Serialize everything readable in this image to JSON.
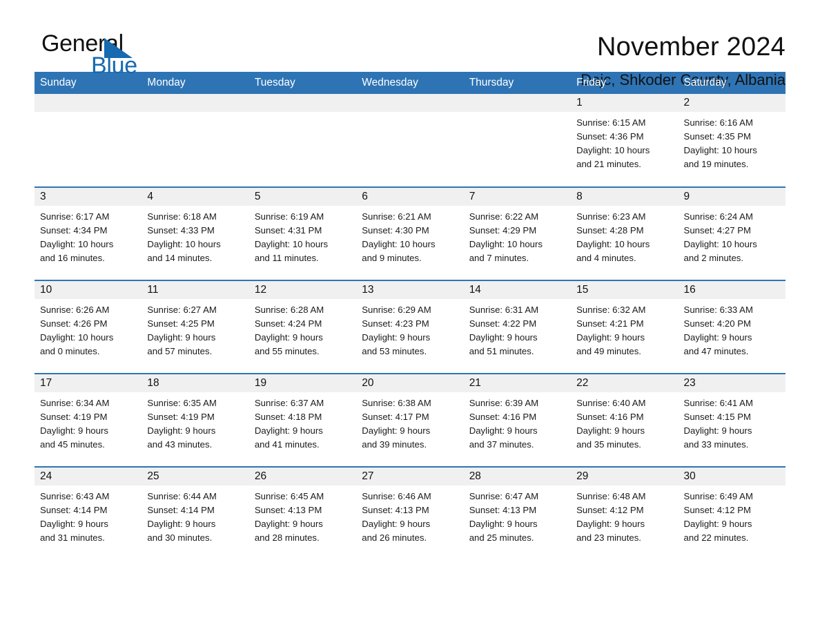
{
  "brand": {
    "name_part1": "General",
    "name_part2": "Blue",
    "triangle_icon": "brand-triangle-icon",
    "accent_color": "#1769b0"
  },
  "header": {
    "title": "November 2024",
    "subtitle": "Dajc, Shkoder County, Albania"
  },
  "colors": {
    "header_blue": "#2e74b5",
    "row_divider_blue": "#2e74b5",
    "daynum_band": "#f0f0f0",
    "text": "#111111",
    "page_background": "#ffffff"
  },
  "calendar": {
    "weekdays": [
      "Sunday",
      "Monday",
      "Tuesday",
      "Wednesday",
      "Thursday",
      "Friday",
      "Saturday"
    ],
    "labels": {
      "sunrise_prefix": "Sunrise: ",
      "sunset_prefix": "Sunset: ",
      "daylight_prefix": "Daylight: "
    },
    "weeks": [
      [
        {
          "day": "",
          "empty": true
        },
        {
          "day": "",
          "empty": true
        },
        {
          "day": "",
          "empty": true
        },
        {
          "day": "",
          "empty": true
        },
        {
          "day": "",
          "empty": true
        },
        {
          "day": "1",
          "sunrise": "Sunrise: 6:15 AM",
          "sunset": "Sunset: 4:36 PM",
          "daylight_line1": "Daylight: 10 hours",
          "daylight_line2": "and 21 minutes."
        },
        {
          "day": "2",
          "sunrise": "Sunrise: 6:16 AM",
          "sunset": "Sunset: 4:35 PM",
          "daylight_line1": "Daylight: 10 hours",
          "daylight_line2": "and 19 minutes."
        }
      ],
      [
        {
          "day": "3",
          "sunrise": "Sunrise: 6:17 AM",
          "sunset": "Sunset: 4:34 PM",
          "daylight_line1": "Daylight: 10 hours",
          "daylight_line2": "and 16 minutes."
        },
        {
          "day": "4",
          "sunrise": "Sunrise: 6:18 AM",
          "sunset": "Sunset: 4:33 PM",
          "daylight_line1": "Daylight: 10 hours",
          "daylight_line2": "and 14 minutes."
        },
        {
          "day": "5",
          "sunrise": "Sunrise: 6:19 AM",
          "sunset": "Sunset: 4:31 PM",
          "daylight_line1": "Daylight: 10 hours",
          "daylight_line2": "and 11 minutes."
        },
        {
          "day": "6",
          "sunrise": "Sunrise: 6:21 AM",
          "sunset": "Sunset: 4:30 PM",
          "daylight_line1": "Daylight: 10 hours",
          "daylight_line2": "and 9 minutes."
        },
        {
          "day": "7",
          "sunrise": "Sunrise: 6:22 AM",
          "sunset": "Sunset: 4:29 PM",
          "daylight_line1": "Daylight: 10 hours",
          "daylight_line2": "and 7 minutes."
        },
        {
          "day": "8",
          "sunrise": "Sunrise: 6:23 AM",
          "sunset": "Sunset: 4:28 PM",
          "daylight_line1": "Daylight: 10 hours",
          "daylight_line2": "and 4 minutes."
        },
        {
          "day": "9",
          "sunrise": "Sunrise: 6:24 AM",
          "sunset": "Sunset: 4:27 PM",
          "daylight_line1": "Daylight: 10 hours",
          "daylight_line2": "and 2 minutes."
        }
      ],
      [
        {
          "day": "10",
          "sunrise": "Sunrise: 6:26 AM",
          "sunset": "Sunset: 4:26 PM",
          "daylight_line1": "Daylight: 10 hours",
          "daylight_line2": "and 0 minutes."
        },
        {
          "day": "11",
          "sunrise": "Sunrise: 6:27 AM",
          "sunset": "Sunset: 4:25 PM",
          "daylight_line1": "Daylight: 9 hours",
          "daylight_line2": "and 57 minutes."
        },
        {
          "day": "12",
          "sunrise": "Sunrise: 6:28 AM",
          "sunset": "Sunset: 4:24 PM",
          "daylight_line1": "Daylight: 9 hours",
          "daylight_line2": "and 55 minutes."
        },
        {
          "day": "13",
          "sunrise": "Sunrise: 6:29 AM",
          "sunset": "Sunset: 4:23 PM",
          "daylight_line1": "Daylight: 9 hours",
          "daylight_line2": "and 53 minutes."
        },
        {
          "day": "14",
          "sunrise": "Sunrise: 6:31 AM",
          "sunset": "Sunset: 4:22 PM",
          "daylight_line1": "Daylight: 9 hours",
          "daylight_line2": "and 51 minutes."
        },
        {
          "day": "15",
          "sunrise": "Sunrise: 6:32 AM",
          "sunset": "Sunset: 4:21 PM",
          "daylight_line1": "Daylight: 9 hours",
          "daylight_line2": "and 49 minutes."
        },
        {
          "day": "16",
          "sunrise": "Sunrise: 6:33 AM",
          "sunset": "Sunset: 4:20 PM",
          "daylight_line1": "Daylight: 9 hours",
          "daylight_line2": "and 47 minutes."
        }
      ],
      [
        {
          "day": "17",
          "sunrise": "Sunrise: 6:34 AM",
          "sunset": "Sunset: 4:19 PM",
          "daylight_line1": "Daylight: 9 hours",
          "daylight_line2": "and 45 minutes."
        },
        {
          "day": "18",
          "sunrise": "Sunrise: 6:35 AM",
          "sunset": "Sunset: 4:19 PM",
          "daylight_line1": "Daylight: 9 hours",
          "daylight_line2": "and 43 minutes."
        },
        {
          "day": "19",
          "sunrise": "Sunrise: 6:37 AM",
          "sunset": "Sunset: 4:18 PM",
          "daylight_line1": "Daylight: 9 hours",
          "daylight_line2": "and 41 minutes."
        },
        {
          "day": "20",
          "sunrise": "Sunrise: 6:38 AM",
          "sunset": "Sunset: 4:17 PM",
          "daylight_line1": "Daylight: 9 hours",
          "daylight_line2": "and 39 minutes."
        },
        {
          "day": "21",
          "sunrise": "Sunrise: 6:39 AM",
          "sunset": "Sunset: 4:16 PM",
          "daylight_line1": "Daylight: 9 hours",
          "daylight_line2": "and 37 minutes."
        },
        {
          "day": "22",
          "sunrise": "Sunrise: 6:40 AM",
          "sunset": "Sunset: 4:16 PM",
          "daylight_line1": "Daylight: 9 hours",
          "daylight_line2": "and 35 minutes."
        },
        {
          "day": "23",
          "sunrise": "Sunrise: 6:41 AM",
          "sunset": "Sunset: 4:15 PM",
          "daylight_line1": "Daylight: 9 hours",
          "daylight_line2": "and 33 minutes."
        }
      ],
      [
        {
          "day": "24",
          "sunrise": "Sunrise: 6:43 AM",
          "sunset": "Sunset: 4:14 PM",
          "daylight_line1": "Daylight: 9 hours",
          "daylight_line2": "and 31 minutes."
        },
        {
          "day": "25",
          "sunrise": "Sunrise: 6:44 AM",
          "sunset": "Sunset: 4:14 PM",
          "daylight_line1": "Daylight: 9 hours",
          "daylight_line2": "and 30 minutes."
        },
        {
          "day": "26",
          "sunrise": "Sunrise: 6:45 AM",
          "sunset": "Sunset: 4:13 PM",
          "daylight_line1": "Daylight: 9 hours",
          "daylight_line2": "and 28 minutes."
        },
        {
          "day": "27",
          "sunrise": "Sunrise: 6:46 AM",
          "sunset": "Sunset: 4:13 PM",
          "daylight_line1": "Daylight: 9 hours",
          "daylight_line2": "and 26 minutes."
        },
        {
          "day": "28",
          "sunrise": "Sunrise: 6:47 AM",
          "sunset": "Sunset: 4:13 PM",
          "daylight_line1": "Daylight: 9 hours",
          "daylight_line2": "and 25 minutes."
        },
        {
          "day": "29",
          "sunrise": "Sunrise: 6:48 AM",
          "sunset": "Sunset: 4:12 PM",
          "daylight_line1": "Daylight: 9 hours",
          "daylight_line2": "and 23 minutes."
        },
        {
          "day": "30",
          "sunrise": "Sunrise: 6:49 AM",
          "sunset": "Sunset: 4:12 PM",
          "daylight_line1": "Daylight: 9 hours",
          "daylight_line2": "and 22 minutes."
        }
      ]
    ]
  }
}
